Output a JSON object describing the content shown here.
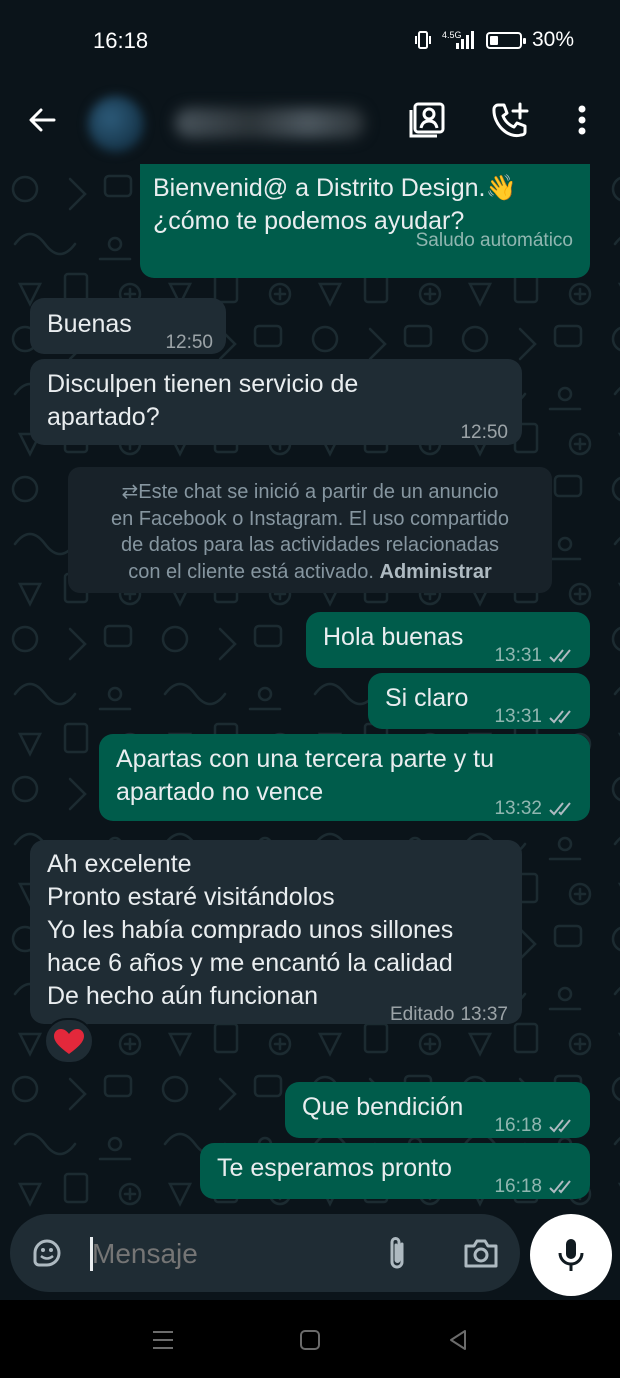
{
  "status_bar": {
    "time": "16:18",
    "network": "4.5G",
    "battery": "30%",
    "battery_level": 0.3
  },
  "app_bar": {
    "contact_name": "",
    "icons": [
      "back-arrow-icon",
      "contact-card-icon",
      "add-call-icon",
      "more-vert-icon"
    ]
  },
  "messages": [
    {
      "direction": "out",
      "lines": [
        "Bienvenid@ a Distrito Design.👋",
        "¿cómo te podemos ayudar?"
      ],
      "meta": "Saludo automático"
    },
    {
      "direction": "in",
      "lines": [
        "Buenas"
      ],
      "time": "12:50"
    },
    {
      "direction": "in",
      "lines": [
        "Disculpen tienen servicio de",
        "apartado?"
      ],
      "time": "12:50"
    },
    {
      "direction": "out",
      "lines": [
        "Hola buenas"
      ],
      "time": "13:31",
      "status": "read"
    },
    {
      "direction": "out",
      "lines": [
        "Si claro"
      ],
      "time": "13:31",
      "status": "read"
    },
    {
      "direction": "out",
      "lines": [
        "Apartas con una tercera parte y tu",
        "apartado no vence"
      ],
      "time": "13:32",
      "status": "read"
    },
    {
      "direction": "in",
      "lines": [
        "Ah excelente",
        "Pronto estaré visitándolos",
        "Yo les había comprado unos sillones",
        "hace 6 años y me encantó la calidad",
        "De hecho aún funcionan"
      ],
      "edited": "Editado",
      "time": "13:37",
      "reaction": "❤"
    },
    {
      "direction": "out",
      "lines": [
        "Que bendición"
      ],
      "time": "16:18",
      "status": "read"
    },
    {
      "direction": "out",
      "lines": [
        "Te esperamos pronto"
      ],
      "time": "16:18",
      "status": "read"
    }
  ],
  "system_notice": {
    "lines": [
      "⇄Este chat se inició a partir de un anuncio",
      "en Facebook o Instagram. El uso compartido",
      "de datos para las actividades relacionadas",
      "con el cliente está activado. "
    ],
    "link": "Administrar"
  },
  "composer": {
    "placeholder": "Mensaje",
    "icons": [
      "sticker-icon",
      "attach-icon",
      "camera-icon",
      "mic-icon"
    ]
  },
  "nav_bar": {
    "icons": [
      "recents-icon",
      "home-icon",
      "back-icon"
    ]
  },
  "colors": {
    "background": "#0b141a",
    "outgoing": "#005c4b",
    "incoming": "#1f2c34",
    "notice": "#182229",
    "read_tick": "#aebac1"
  }
}
